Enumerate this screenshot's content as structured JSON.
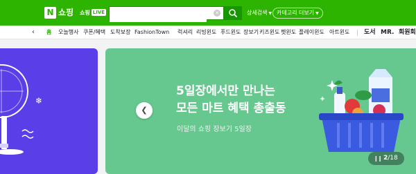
{
  "header": {
    "logo_letter": "N",
    "logo_text": "쇼핑",
    "live_label": "쇼핑",
    "live_badge": "LIVE",
    "search_value": "",
    "search_placeholder": "",
    "detail_search": "상세검색",
    "category_view": "카테고리 더보기"
  },
  "nav": {
    "items": [
      "홈",
      "오늘행사",
      "쿠폰/혜택",
      "도착보장",
      "FashionTown",
      "럭셔리",
      "리빙윈도",
      "푸드윈도",
      "장보기",
      "키즈윈도",
      "펫윈도",
      "플레이윈도",
      "아트윈도",
      "도서",
      "MR.",
      "회원회"
    ]
  },
  "banner": {
    "headline_line1": "5일장에서만 만나는",
    "headline_line2": "모든 마트 혜택 총출동",
    "subline": "이달의 쇼핑 장보기 5일장",
    "page_current": "2",
    "page_total": "/18"
  },
  "colors": {
    "brand_green": "#2db400",
    "banner_green": "#66c78f",
    "left_banner_purple": "#5a3fe8"
  }
}
